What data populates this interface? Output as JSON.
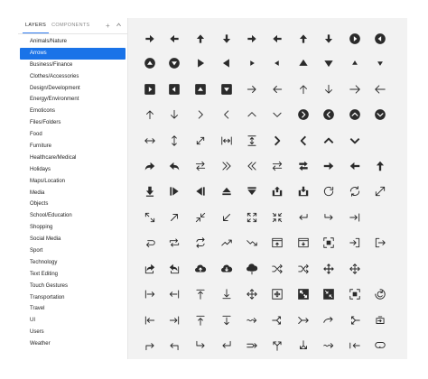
{
  "tabs": [
    {
      "label": "LAYERS",
      "active": true
    },
    {
      "label": "COMPONENTS",
      "active": false
    }
  ],
  "tab_actions": {
    "add": "+",
    "collapse": "^"
  },
  "categories": [
    "Animals/Nature",
    "Arrows",
    "Business/Finance",
    "Clothes/Accessories",
    "Design/Development",
    "Energy/Environment",
    "Emoticons",
    "Files/Folders",
    "Food",
    "Furniture",
    "Healthcare/Medical",
    "Holidays",
    "Maps/Location",
    "Media",
    "Objects",
    "School/Education",
    "Shopping",
    "Social Media",
    "Sport",
    "Technology",
    "Text Editing",
    "Touch Gestures",
    "Transportation",
    "Travel",
    "UI",
    "Users",
    "Weather"
  ],
  "selected_category": "Arrows",
  "icon_color": "#2b2b2b",
  "accent_color": "#1a73e8",
  "icons": [
    [
      "arrow-right-filled",
      "arrow-left-filled",
      "arrow-up-filled",
      "arrow-down-filled",
      "arrow-right-filled",
      "arrow-left-filled",
      "arrow-up-filled",
      "arrow-down-filled",
      "circle-play-right",
      "circle-play-left"
    ],
    [
      "circle-triangle-up",
      "circle-triangle-down",
      "triangle-right",
      "triangle-left",
      "triangle-right-small",
      "triangle-left-small",
      "triangle-up",
      "triangle-down",
      "triangle-up-small",
      "triangle-down-small"
    ],
    [
      "square-play-right",
      "square-play-left",
      "square-triangle-up",
      "square-triangle-down",
      "arrow-right-thin",
      "arrow-left-thin",
      "arrow-up-thin",
      "arrow-down-thin",
      "arrow-right-line",
      "arrow-left-line"
    ],
    [
      "arrow-up-line",
      "arrow-down-line",
      "chevron-right",
      "chevron-left",
      "chevron-up",
      "chevron-down",
      "circle-chevron-right",
      "circle-chevron-left",
      "circle-chevron-up",
      "circle-chevron-down"
    ],
    [
      "arrows-horizontal",
      "arrows-vertical",
      "arrows-diagonal",
      "arrows-horizontal-bar",
      "arrows-vertical-bar",
      "chevron-right-bold",
      "chevron-left-bold",
      "chevron-up-bold",
      "chevron-down-bold",
      "blank"
    ],
    [
      "share-forward",
      "reply",
      "exchange-horizontal",
      "chevron-double-right",
      "chevron-double-left",
      "swap-horizontal",
      "swap-horizontal-bold",
      "arrow-right-bold",
      "arrow-left-bold",
      "arrow-up-bold"
    ],
    [
      "arrow-down-to-line",
      "bar-triangle-right",
      "bar-triangle-left",
      "eject",
      "triangle-down-bar",
      "upload-box",
      "download-box",
      "rotate-cw",
      "sync",
      "expand-diagonal"
    ],
    [
      "expand-corners",
      "arrow-up-right",
      "shrink-diagonal",
      "arrow-down-left",
      "arrows-out",
      "arrows-in",
      "return-left",
      "return-right",
      "arrow-right-to-line",
      "blank"
    ],
    [
      "loop-left",
      "repeat",
      "repeat-alt",
      "trending-up",
      "trending-down",
      "window-arrow-up",
      "window-arrow-down",
      "frame-corners",
      "login-arrow",
      "logout-arrow"
    ],
    [
      "share-box",
      "reply-box",
      "cloud-upload",
      "cloud-download",
      "cloud-upload-alt",
      "shuffle",
      "shuffle-alt",
      "move",
      "move-alt",
      "blank"
    ],
    [
      "arrow-right-to-bar",
      "arrow-left-to-bar",
      "arrow-up-to-bar",
      "arrow-down-to-bar",
      "move-thin",
      "move-square",
      "expand-square",
      "collapse-square",
      "focus-square",
      "refresh-circle"
    ],
    [
      "arrow-left-to-bar-alt",
      "arrow-right-to-bar-alt",
      "arrow-up-bar-alt",
      "arrow-down-bar-alt",
      "arrow-right-wavy",
      "split-arrow",
      "merge-arrow",
      "arrow-right-curved",
      "split-left",
      "battery-loop"
    ],
    [
      "corner-up-right",
      "corner-up-left",
      "corner-down-right",
      "corner-down-left",
      "arrow-right-split",
      "arrow-branch",
      "arrow-split-down",
      "arrow-right-wavy-alt",
      "arrow-left-swap",
      "loop-rounded"
    ]
  ]
}
